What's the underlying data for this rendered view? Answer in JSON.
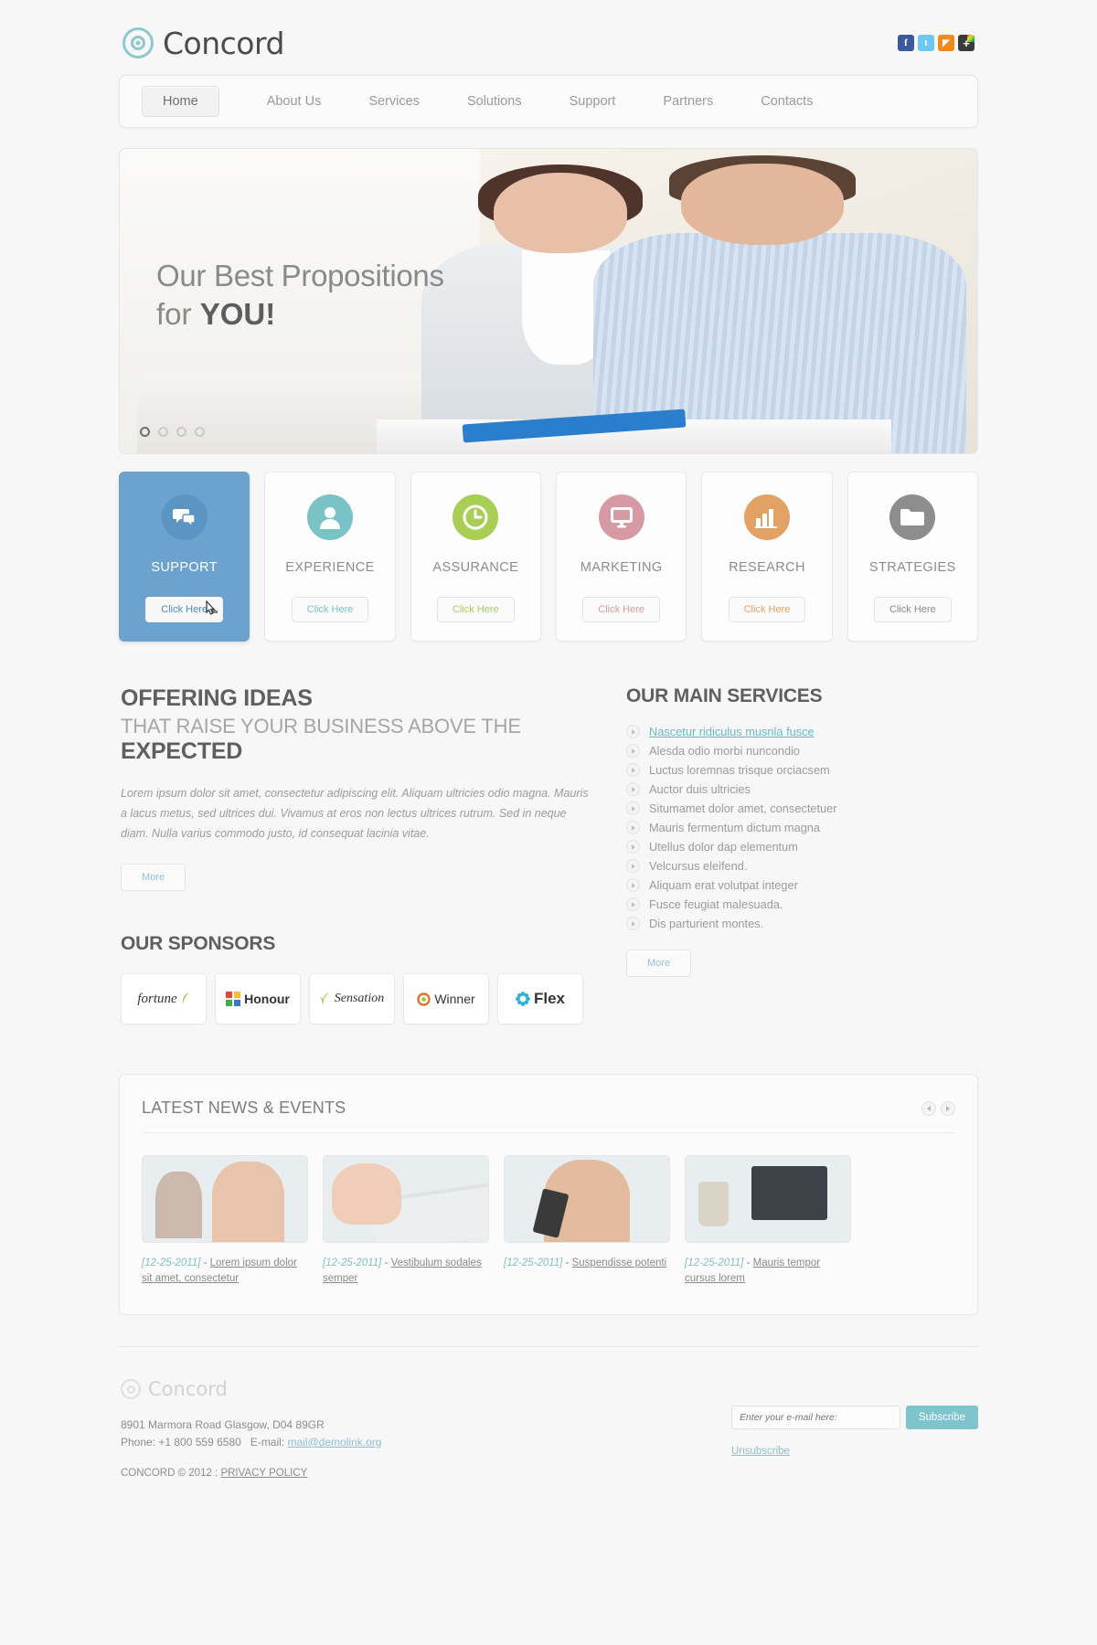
{
  "brand": {
    "name": "Concord",
    "logo_icon": "target-icon"
  },
  "social": [
    {
      "name": "facebook-icon",
      "glyph": "f"
    },
    {
      "name": "twitter-icon",
      "glyph": "t"
    },
    {
      "name": "rss-icon",
      "glyph": "◤"
    },
    {
      "name": "share-icon",
      "glyph": "+"
    }
  ],
  "nav": {
    "items": [
      {
        "label": "Home",
        "active": true
      },
      {
        "label": "About Us",
        "active": false
      },
      {
        "label": "Services",
        "active": false
      },
      {
        "label": "Solutions",
        "active": false
      },
      {
        "label": "Support",
        "active": false
      },
      {
        "label": "Partners",
        "active": false
      },
      {
        "label": "Contacts",
        "active": false
      }
    ]
  },
  "slider": {
    "line1": "Our Best Propositions",
    "line2_pre": "for ",
    "line2_strong": "YOU!",
    "dots": 4,
    "active_dot": 1
  },
  "boxes": [
    {
      "label": "SUPPORT",
      "button": "Click Here",
      "color": "#4e8ebd",
      "circle": "#4e8ebd",
      "icon": "chat-bubbles-icon",
      "active": true
    },
    {
      "label": "EXPERIENCE",
      "button": "Click Here",
      "color": "#79c2c6",
      "circle": "#79c2c6",
      "icon": "user-icon",
      "active": false
    },
    {
      "label": "ASSURANCE",
      "button": "Click Here",
      "color": "#a8ce54",
      "circle": "#a8ce54",
      "icon": "clock-icon",
      "active": false
    },
    {
      "label": "MARKETING",
      "button": "Click Here",
      "color": "#d79aa4",
      "circle": "#d79aa4",
      "icon": "monitor-icon",
      "active": false
    },
    {
      "label": "RESEARCH",
      "button": "Click Here",
      "color": "#e1a263",
      "circle": "#e1a263",
      "icon": "bar-chart-icon",
      "active": false
    },
    {
      "label": "STRATEGIES",
      "button": "Click Here",
      "color": "#8d8d8d",
      "circle": "#8d8d8d",
      "icon": "folder-icon",
      "active": false
    }
  ],
  "offering": {
    "title": "OFFERING IDEAS",
    "subtitle_pre": "THAT RAISE YOUR BUSINESS ABOVE THE ",
    "subtitle_strong": "EXPECTED",
    "paragraph": "Lorem ipsum dolor sit amet, consectetur adipiscing elit. Aliquam ultricies odio magna. Mauris a lacus metus, sed ultrices dui. Vivamus at eros non lectus ultrices rutrum. Sed in neque diam. Nulla varius commodo justo, id consequat lacinia vitae.",
    "more_label": "More"
  },
  "sponsors": {
    "title": "OUR SPONSORS",
    "items": [
      {
        "name": "fortune",
        "label": "fortune"
      },
      {
        "name": "honour",
        "label": "Honour"
      },
      {
        "name": "sensation",
        "label": "Sensation"
      },
      {
        "name": "winner",
        "label": "Winner"
      },
      {
        "name": "flex",
        "label": "Flex"
      }
    ]
  },
  "services": {
    "title": "OUR MAIN SERVICES",
    "items": [
      {
        "label": "Nascetur ridiculus musnla fusce",
        "highlighted": true
      },
      {
        "label": "Alesda odio morbi nuncondio",
        "highlighted": false
      },
      {
        "label": "Luctus loremnas trisque orciacsem",
        "highlighted": false
      },
      {
        "label": "Auctor duis ultricies",
        "highlighted": false
      },
      {
        "label": "Situmamet dolor amet, consectetuer",
        "highlighted": false
      },
      {
        "label": "Mauris fermentum dictum magna",
        "highlighted": false
      },
      {
        "label": "Utellus dolor dap elementum",
        "highlighted": false
      },
      {
        "label": "Velcursus eleifend.",
        "highlighted": false
      },
      {
        "label": "Aliquam erat volutpat integer",
        "highlighted": false
      },
      {
        "label": "Fusce feugiat malesuada.",
        "highlighted": false
      },
      {
        "label": "Dis parturient  montes.",
        "highlighted": false
      }
    ],
    "more_label": "More"
  },
  "news": {
    "title": "LATEST NEWS & EVENTS",
    "prev_icon": "chevron-left-icon",
    "next_icon": "chevron-right-icon",
    "items": [
      {
        "date": "[12-25-2011]",
        "sep": " - ",
        "title": "Lorem ipsum dolor sit amet, consectetur",
        "thumb": "business-people-photo"
      },
      {
        "date": "[12-25-2011]",
        "sep": " - ",
        "title": "Vestibulum sodales semper",
        "thumb": "keyboard-hands-photo"
      },
      {
        "date": "[12-25-2011]",
        "sep": " - ",
        "title": "Suspendisse potenti",
        "thumb": "headset-support-photo"
      },
      {
        "date": "[12-25-2011]",
        "sep": " - ",
        "title": "Mauris tempor cursus lorem",
        "thumb": "desk-laptop-photo"
      }
    ]
  },
  "footer": {
    "brand": "Concord",
    "address": "8901 Marmora Road Glasgow, D04 89GR",
    "phone_label": "Phone: +1 800 559 6580",
    "email_label": "E-mail:",
    "email": "mail@demolink.org",
    "copyright": "CONCORD © 2012 : ",
    "privacy": "PRIVACY POLICY",
    "subscribe": {
      "placeholder": "Enter your e-mail here:",
      "value": "",
      "button": "Subscribe",
      "unsubscribe": "Unsubscribe"
    }
  }
}
